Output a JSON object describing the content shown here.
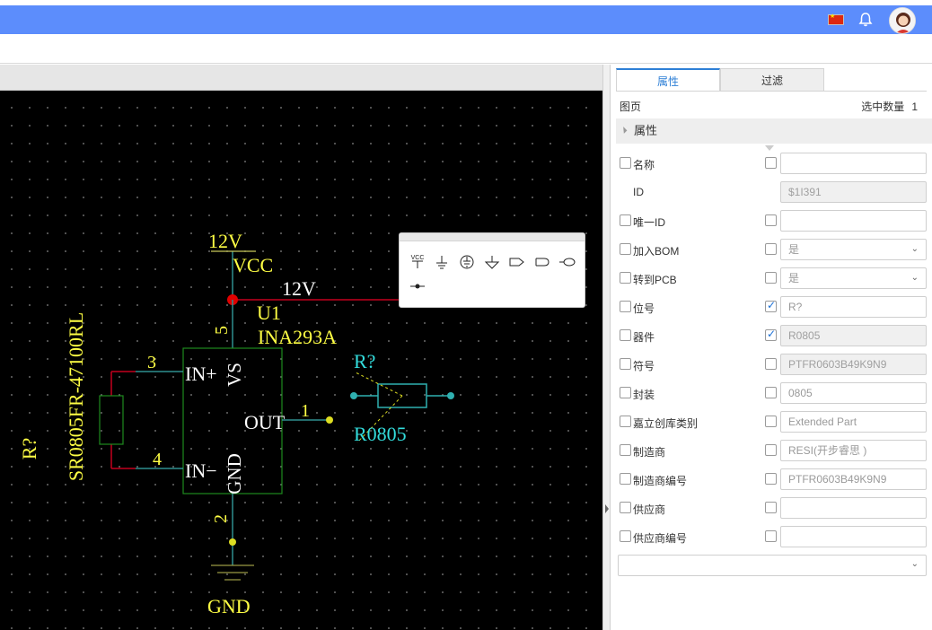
{
  "header": {
    "language_flag": "flag-cn-icon",
    "bell": "bell-icon",
    "avatar": "avatar-icon",
    "accent": "#5c8dfc"
  },
  "schematic": {
    "net_label_top": "12V",
    "power_symbol": "VCC",
    "net_label_wire": "12V",
    "u1_designator": "U1",
    "u1_part": "INA293A",
    "pin5": "5",
    "pin3": "3",
    "pin4": "4",
    "pin1": "1",
    "pin2": "2",
    "pin_vs": "VS",
    "pin_inp": "IN+",
    "pin_inn": "IN−",
    "pin_out": "OUT",
    "pin_gnd": "GND",
    "gnd_label": "GND",
    "r_left_designator": "R?",
    "r_left_part": "SR0805FR-47100RL",
    "r_right_designator": "R?",
    "r_right_part": "R0805"
  },
  "popup": {
    "icons": [
      "vcc-power-icon",
      "ground-icon",
      "earth-ground-icon",
      "signal-ground-icon",
      "net-port-in-icon",
      "net-port-out-icon",
      "net-port-bidir-icon",
      "net-flag-icon"
    ],
    "vcc_text": "VCC"
  },
  "panel": {
    "tabs": [
      {
        "label": "属性",
        "active": true
      },
      {
        "label": "过滤",
        "active": false
      }
    ],
    "page_label": "图页",
    "selected_count_label": "选中数量",
    "selected_count": "1",
    "section_title": "属性",
    "rows": [
      {
        "label": "名称",
        "value": "",
        "checked": false,
        "has_cb": true
      },
      {
        "label": "ID",
        "value": "$1I391",
        "checked": false,
        "has_cb": false
      },
      {
        "label": "唯一ID",
        "value": "",
        "checked": false,
        "has_cb": true
      },
      {
        "label": "加入BOM",
        "value": "是",
        "checked": false,
        "has_cb": true
      },
      {
        "label": "转到PCB",
        "value": "是",
        "checked": false,
        "has_cb": true
      },
      {
        "label": "位号",
        "value": "R?",
        "checked": true,
        "has_cb": true
      },
      {
        "label": "器件",
        "value": "R0805",
        "checked": true,
        "has_cb": true
      },
      {
        "label": "符号",
        "value": "PTFR0603B49K9N9",
        "checked": false,
        "has_cb": true
      },
      {
        "label": "封装",
        "value": "0805",
        "checked": false,
        "has_cb": true
      },
      {
        "label": "嘉立创库类别",
        "value": "Extended Part",
        "checked": false,
        "has_cb": true
      },
      {
        "label": "制造商",
        "value": "RESI(开步睿思 )",
        "checked": false,
        "has_cb": true
      },
      {
        "label": "制造商编号",
        "value": "PTFR0603B49K9N9",
        "checked": false,
        "has_cb": true
      },
      {
        "label": "供应商",
        "value": "",
        "checked": false,
        "has_cb": true
      },
      {
        "label": "供应商编号",
        "value": "",
        "checked": false,
        "has_cb": true
      }
    ]
  }
}
